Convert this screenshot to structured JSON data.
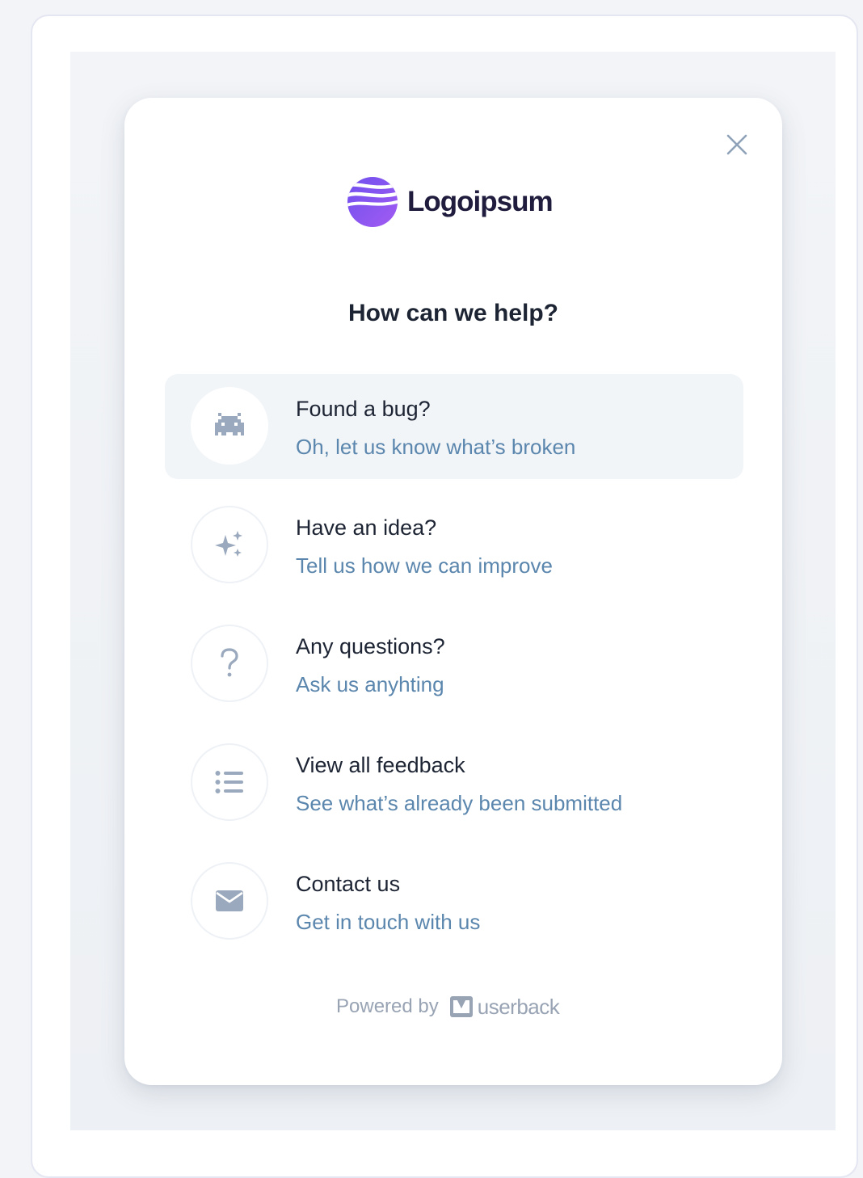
{
  "brand": {
    "name": "Logoipsum",
    "color_primary": "#7b5cf0",
    "color_secondary": "#a25cf0"
  },
  "heading": "How can we help?",
  "options": [
    {
      "title": "Found a bug?",
      "subtitle": "Oh, let us know what’s broken",
      "icon": "bug-icon",
      "active": true
    },
    {
      "title": "Have an idea?",
      "subtitle": "Tell us how we can improve",
      "icon": "sparkles-icon",
      "active": false
    },
    {
      "title": "Any questions?",
      "subtitle": "Ask us anyhting",
      "icon": "question-icon",
      "active": false
    },
    {
      "title": "View all feedback",
      "subtitle": "See what’s already been submitted",
      "icon": "list-icon",
      "active": false
    },
    {
      "title": "Contact us",
      "subtitle": "Get in touch with us",
      "icon": "mail-icon",
      "active": false
    }
  ],
  "footer": {
    "powered_by": "Powered by",
    "provider": "userback"
  },
  "colors": {
    "title_text": "#1d2433",
    "subtitle_text": "#5b86ad",
    "icon_color": "#9aa9bd",
    "active_row_bg": "#f2f5f8"
  }
}
